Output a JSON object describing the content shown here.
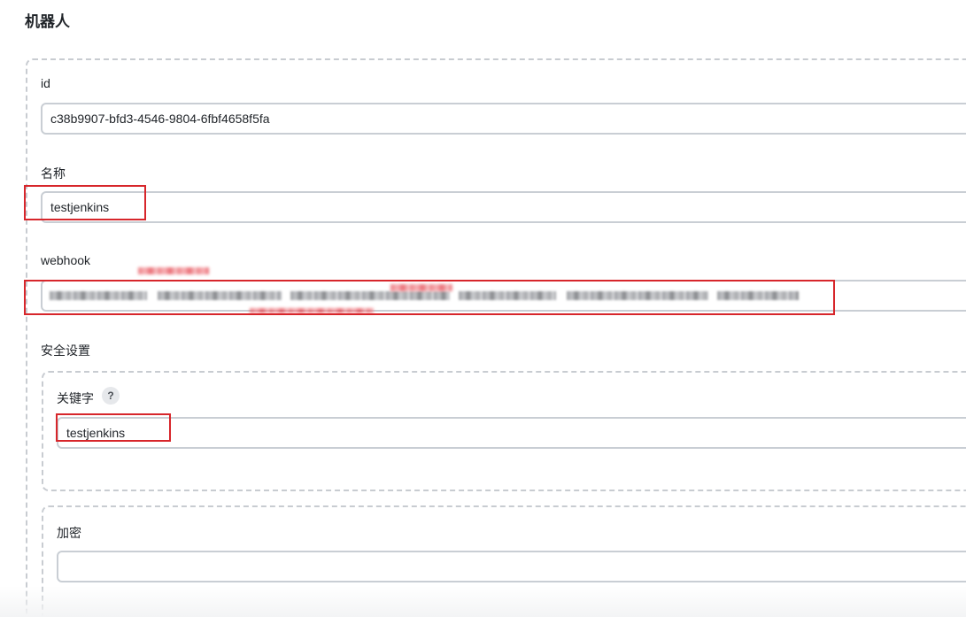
{
  "section": {
    "title": "机器人"
  },
  "fields": {
    "id": {
      "label": "id",
      "value": "c38b9907-bfd3-4546-9804-6fbf4658f5fa"
    },
    "name": {
      "label": "名称",
      "value": "testjenkins"
    },
    "webhook": {
      "label": "webhook",
      "value": ""
    }
  },
  "security": {
    "label": "安全设置",
    "keyword": {
      "label": "关键字",
      "help": "?",
      "value": "testjenkins"
    },
    "encryption": {
      "label": "加密",
      "value": ""
    }
  },
  "colors": {
    "highlight": "#d7262b",
    "border": "#c9ced4",
    "dashed": "#c8ccd1"
  }
}
